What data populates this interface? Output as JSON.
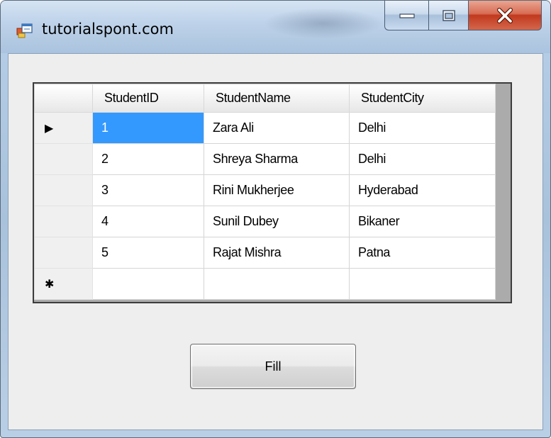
{
  "window": {
    "title": "tutorialspont.com",
    "icons": {
      "app": "form-app-icon",
      "minimize": "minimize-icon",
      "maximize": "maximize-icon",
      "close": "close-icon"
    },
    "colors": {
      "selection": "#3399ff",
      "close_button": "#c1391e"
    }
  },
  "grid": {
    "columns": [
      "StudentID",
      "StudentName",
      "StudentCity"
    ],
    "current_row_indicator": "▶",
    "new_row_indicator": "✱",
    "selected_cell": {
      "row": 0,
      "column": "StudentID"
    },
    "rows": [
      {
        "id": "1",
        "name": "Zara Ali",
        "city": "Delhi"
      },
      {
        "id": "2",
        "name": "Shreya Sharma",
        "city": "Delhi"
      },
      {
        "id": "3",
        "name": "Rini Mukherjee",
        "city": "Hyderabad"
      },
      {
        "id": "4",
        "name": "Sunil Dubey",
        "city": "Bikaner"
      },
      {
        "id": "5",
        "name": "Rajat Mishra",
        "city": "Patna"
      }
    ]
  },
  "buttons": {
    "fill_label": "Fill"
  }
}
